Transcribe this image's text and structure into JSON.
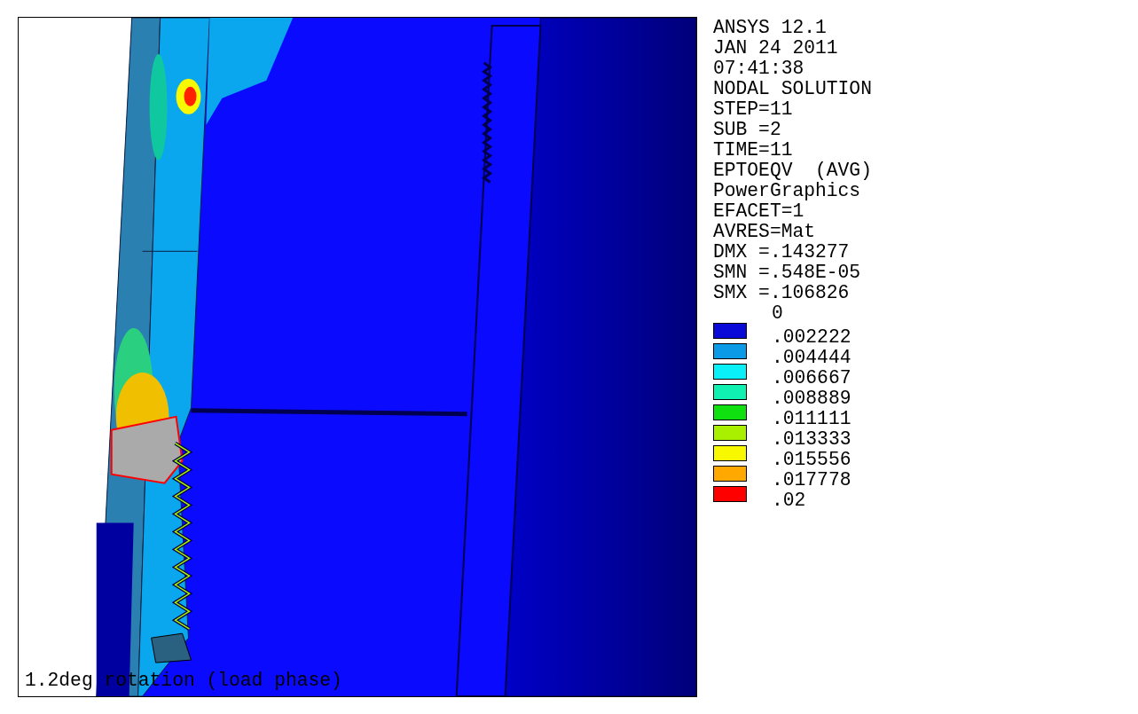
{
  "info_lines": [
    "ANSYS 12.1",
    "JAN 24 2011",
    "07:41:38",
    "NODAL SOLUTION",
    "STEP=11",
    "SUB =2",
    "TIME=11",
    "EPTOEQV  (AVG)",
    "PowerGraphics",
    "EFACET=1",
    "AVRES=Mat",
    "DMX =.143277",
    "SMN =.548E-05",
    "SMX =.106826"
  ],
  "legend": {
    "min_label": "0",
    "items": [
      {
        "label": ".002222",
        "color": "#0a0ad8"
      },
      {
        "label": ".004444",
        "color": "#0a9ae6"
      },
      {
        "label": ".006667",
        "color": "#0af0f8"
      },
      {
        "label": ".008889",
        "color": "#10f0b0"
      },
      {
        "label": ".011111",
        "color": "#10e010"
      },
      {
        "label": ".013333",
        "color": "#a8f000"
      },
      {
        "label": ".015556",
        "color": "#f8f800"
      },
      {
        "label": ".017778",
        "color": "#ffa800"
      },
      {
        "label": ".02",
        "color": "#ff0000"
      }
    ]
  },
  "caption": "1.2deg rotation (load phase)"
}
